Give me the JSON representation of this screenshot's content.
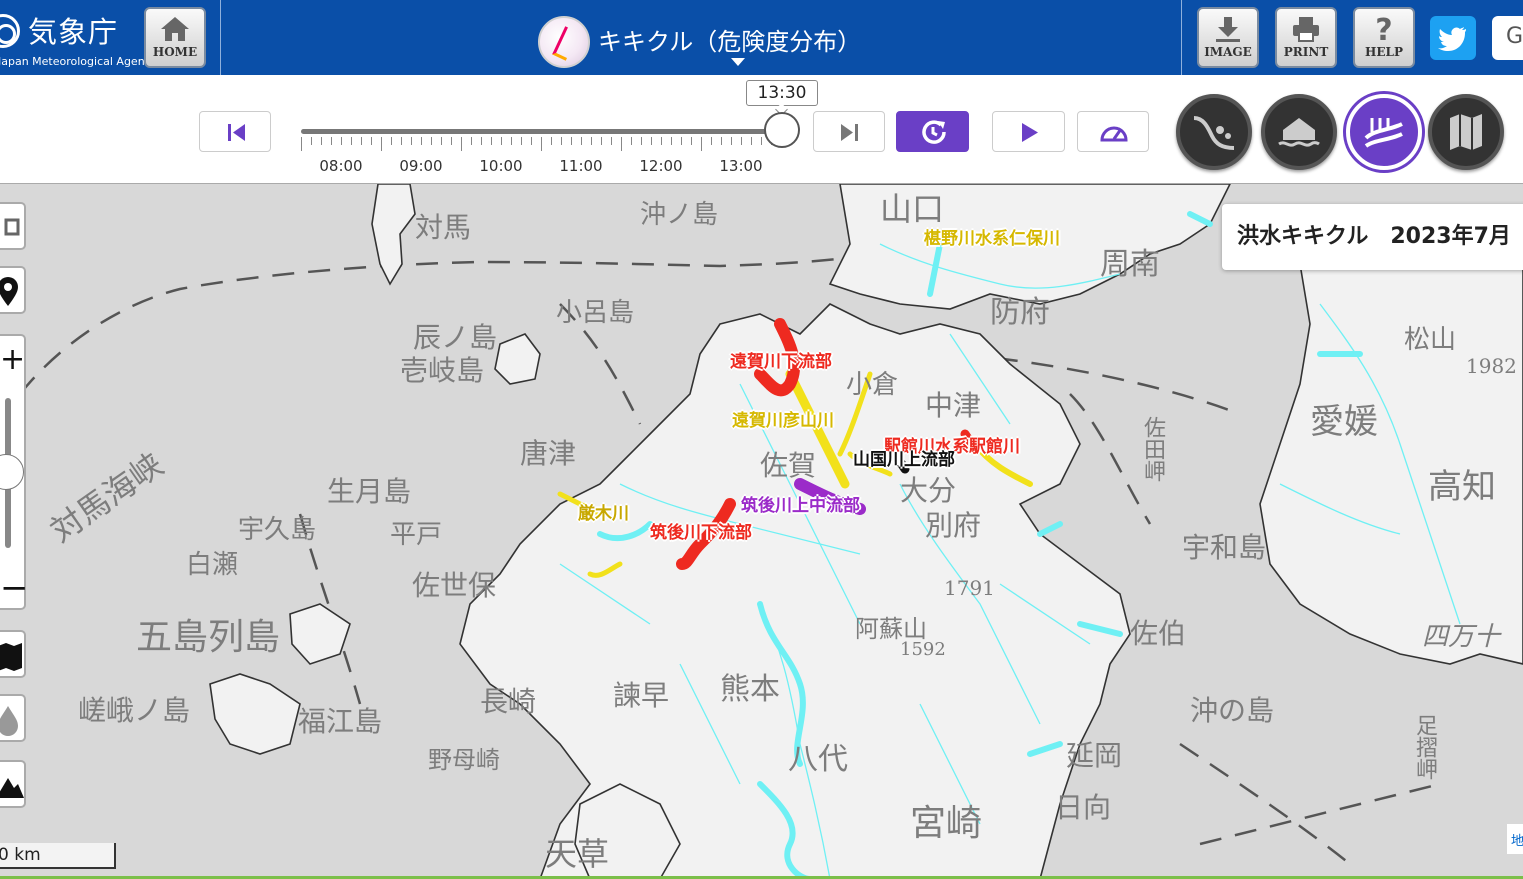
{
  "header": {
    "agency_name": "気象庁",
    "agency_sub": "Japan Meteorological Agency",
    "home_label": "HOME",
    "app_title": "キキクル（危険度分布）",
    "image_label": "IMAGE",
    "print_label": "PRINT",
    "help_label": "HELP",
    "google_label": "G"
  },
  "timeline": {
    "current_time": "13:30",
    "tick_labels": [
      "08:00",
      "09:00",
      "10:00",
      "11:00",
      "12:00",
      "13:00"
    ],
    "position": 1.0
  },
  "layers": {
    "items": [
      {
        "name": "landslide",
        "icon": "landslide-icon",
        "active": false
      },
      {
        "name": "flood-inundation",
        "icon": "inundation-icon",
        "active": false
      },
      {
        "name": "flood",
        "icon": "flood-icon",
        "active": true
      },
      {
        "name": "map",
        "icon": "map-icon",
        "active": false
      }
    ],
    "active_color": "#6a3fc6"
  },
  "info_panel": {
    "text": "洪水キキクル　2023年7月"
  },
  "map": {
    "scale_label": "0 km",
    "attribution_label": "地",
    "place_labels": {
      "tsushima": "対馬",
      "okinoshima": "沖ノ島",
      "yamaguchi": "山口",
      "kojima": "小呂島",
      "tatsunoshima": "辰ノ島",
      "ikishima": "壱岐島",
      "tsushima_strait": "対馬海峡",
      "hofu": "防府",
      "shunan": "周南",
      "nakatsu": "中津",
      "ikitsukishima": "生月島",
      "ukushima": "宇久島",
      "hirado": "平戸",
      "shirase": "白瀬",
      "karatsu": "唐津",
      "sasebo": "佐世保",
      "goto": "五島列島",
      "nagasaki": "長崎",
      "isahaya": "諫早",
      "saga": "佐賀",
      "kumamoto": "熊本",
      "yatsushiro": "八代",
      "aso": "阿蘇山",
      "beppu": "別府",
      "oita": "大分",
      "uwajima": "宇和島",
      "saiki": "佐伯",
      "nobeoka": "延岡",
      "hyuga": "日向",
      "miyazaki": "宮崎",
      "amakusa": "天草",
      "fukue": "福江島",
      "nomozaki": "野母崎",
      "sagaroshima": "嵯峨ノ島",
      "ehime": "愛媛",
      "kochi": "高知",
      "okinoshima2": "沖の島",
      "ashizuri": "足摺岬",
      "shimanto": "四万十",
      "satamisaki": "佐田岬",
      "hiei": "1982",
      "kuju": "1791",
      "aso_elev": "1592",
      "matsuyama": "松山",
      "kokura": "小倉"
    },
    "rivers": [
      {
        "name": "遠賀川下流部",
        "level": "red"
      },
      {
        "name": "遠賀川彦山川",
        "level": "yellow"
      },
      {
        "name": "駅館川水系駅館川",
        "level": "red"
      },
      {
        "name": "山国川上流部",
        "level": "black"
      },
      {
        "name": "筑後川上中流部",
        "level": "purple"
      },
      {
        "name": "筑後川下流部",
        "level": "red"
      },
      {
        "name": "厳木川",
        "level": "yellow"
      },
      {
        "name": "椹野川水系仁保川",
        "level": "yellow"
      }
    ],
    "colors": {
      "land": "#f2f2f2",
      "sea": "#d8d8d8",
      "river_base": "#6ff0f4",
      "level_yellow": "#f2e11b",
      "level_red": "#ee2a20",
      "level_purple": "#9b2bc9",
      "level_black": "#111111"
    }
  }
}
